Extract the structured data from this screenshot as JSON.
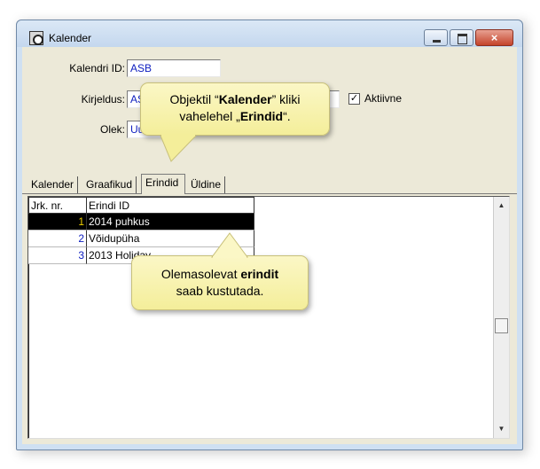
{
  "window": {
    "title": "Kalender",
    "icon": "calendar-app-icon",
    "controls": [
      "minimize",
      "maximize",
      "close"
    ],
    "close_glyph": "×"
  },
  "form": {
    "calendar_id_label": "Kalendri ID:",
    "calendar_id_value": "ASB",
    "description_label": "Kirjeldus:",
    "description_value": "AS",
    "status_label": "Olek:",
    "status_value": "Uu",
    "active_checkbox_label": "Aktiivne",
    "active_checked": true,
    "check_glyph": "✓"
  },
  "tabs": [
    {
      "label": "Kalender",
      "active": false
    },
    {
      "label": "Graafikud",
      "active": false
    },
    {
      "label": "Erindid",
      "active": true
    },
    {
      "label": "Üldine",
      "active": false
    }
  ],
  "grid": {
    "columns": [
      "Jrk. nr.",
      "Erindi ID"
    ],
    "rows": [
      {
        "nr": "1",
        "id": "2014 puhkus",
        "selected": true
      },
      {
        "nr": "2",
        "id": "Võidupüha",
        "selected": false
      },
      {
        "nr": "3",
        "id": "2013 Holiday",
        "selected": false
      }
    ]
  },
  "scrollbar": {
    "up_glyph": "▲",
    "down_glyph": "▼"
  },
  "callouts": {
    "top": {
      "line1_before": "Objektil “",
      "line1_bold": "Kalender",
      "line1_after": "” kliki",
      "line2_before": "vahelehel „",
      "line2_bold": "Erindid",
      "line2_after": "“."
    },
    "bottom": {
      "line1_before": "Olemasolevat ",
      "line1_bold": "erindit",
      "line2": "saab kustutada."
    }
  },
  "colors": {
    "callout_fill": "#f8f3b0",
    "selected_row": "#000000",
    "selected_number": "#f0d000",
    "field_text": "#1020c0"
  }
}
